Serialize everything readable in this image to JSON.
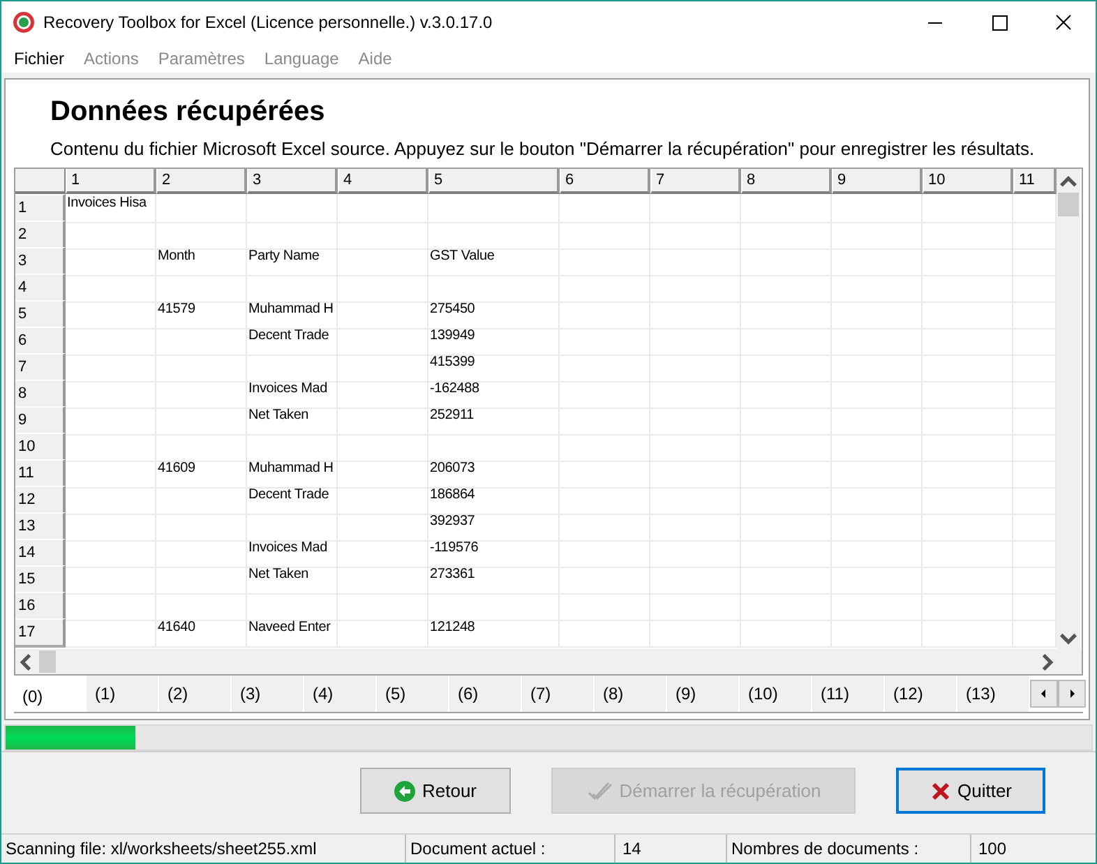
{
  "window": {
    "title": "Recovery Toolbox for Excel (Licence personnelle.) v.3.0.17.0"
  },
  "menu": [
    {
      "label": "Fichier",
      "disabled": false
    },
    {
      "label": "Actions",
      "disabled": true
    },
    {
      "label": "Paramètres",
      "disabled": true
    },
    {
      "label": "Language",
      "disabled": true
    },
    {
      "label": "Aide",
      "disabled": true
    }
  ],
  "heading": "Données récupérées",
  "description": "Contenu du fichier Microsoft Excel source. Appuyez sur le bouton \"Démarrer la récupération\" pour enregistrer les résultats.",
  "grid": {
    "columns": [
      "1",
      "2",
      "3",
      "4",
      "5",
      "6",
      "7",
      "8",
      "9",
      "10",
      "11"
    ],
    "rows": [
      {
        "label": "1",
        "cells": [
          "Invoices Hisa"
        ]
      },
      {
        "label": "2",
        "cells": []
      },
      {
        "label": "3",
        "cells": [
          null,
          "Month",
          "Party Name",
          null,
          "GST Value"
        ]
      },
      {
        "label": "4",
        "cells": []
      },
      {
        "label": "5",
        "cells": [
          null,
          "41579",
          "Muhammad H",
          null,
          "275450"
        ]
      },
      {
        "label": "6",
        "cells": [
          null,
          null,
          "Decent Trade",
          null,
          "139949"
        ]
      },
      {
        "label": "7",
        "cells": [
          null,
          null,
          null,
          null,
          "415399"
        ]
      },
      {
        "label": "8",
        "cells": [
          null,
          null,
          "Invoices Mad",
          null,
          "-162488"
        ]
      },
      {
        "label": "9",
        "cells": [
          null,
          null,
          "Net Taken",
          null,
          "252911"
        ]
      },
      {
        "label": "10",
        "cells": []
      },
      {
        "label": "11",
        "cells": [
          null,
          "41609",
          "Muhammad H",
          null,
          "206073"
        ]
      },
      {
        "label": "12",
        "cells": [
          null,
          null,
          "Decent Trade",
          null,
          "186864"
        ]
      },
      {
        "label": "13",
        "cells": [
          null,
          null,
          null,
          null,
          "392937"
        ]
      },
      {
        "label": "14",
        "cells": [
          null,
          null,
          "Invoices Mad",
          null,
          "-119576"
        ]
      },
      {
        "label": "15",
        "cells": [
          null,
          null,
          "Net Taken",
          null,
          "273361"
        ]
      },
      {
        "label": "16",
        "cells": []
      },
      {
        "label": "17",
        "cells": [
          null,
          "41640",
          "Naveed Enter",
          null,
          "121248"
        ]
      }
    ]
  },
  "sheet_tabs": [
    {
      "label": "(0)",
      "selected": true
    },
    {
      "label": "(1)",
      "selected": false
    },
    {
      "label": "(2)",
      "selected": false
    },
    {
      "label": "(3)",
      "selected": false
    },
    {
      "label": "(4)",
      "selected": false
    },
    {
      "label": "(5)",
      "selected": false
    },
    {
      "label": "(6)",
      "selected": false
    },
    {
      "label": "(7)",
      "selected": false
    },
    {
      "label": "(8)",
      "selected": false
    },
    {
      "label": "(9)",
      "selected": false
    },
    {
      "label": "(10)",
      "selected": false
    },
    {
      "label": "(11)",
      "selected": false
    },
    {
      "label": "(12)",
      "selected": false
    },
    {
      "label": "(13)",
      "selected": false
    }
  ],
  "progress": {
    "level": 0.12
  },
  "buttons": [
    {
      "kind": "back",
      "label": "Retour",
      "disabled": false,
      "focused": false
    },
    {
      "kind": "start",
      "label": "Démarrer la récupération",
      "disabled": true,
      "focused": false
    },
    {
      "kind": "quit",
      "label": "Quitter",
      "disabled": false,
      "focused": true
    }
  ],
  "status_bar": [
    {
      "kind": "label",
      "text": "Scanning file: xl/worksheets/sheet255.xml"
    },
    {
      "kind": "label",
      "text": "Document actuel :"
    },
    {
      "kind": "value",
      "text": "14"
    },
    {
      "kind": "label",
      "text": "Nombres de documents :"
    },
    {
      "kind": "value",
      "text": "100"
    }
  ]
}
